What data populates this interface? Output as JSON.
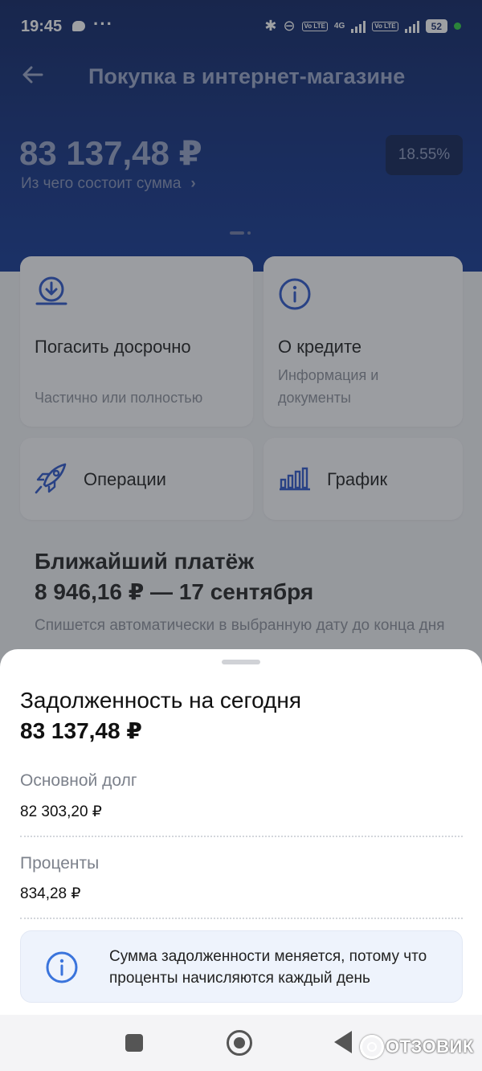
{
  "statusbar": {
    "time": "19:45",
    "dots": "···",
    "network": "4G",
    "volte1": "Vo LTE",
    "volte2": "Vo LTE",
    "battery": "52"
  },
  "header": {
    "title": "Покупка в интернет-магазине",
    "amount": "83 137,48 ₽",
    "amount_breakdown_link": "Из чего состоит сумма",
    "rate": "18.55%"
  },
  "actions": [
    {
      "title": "Погасить досрочно",
      "subtitle": "Частично или полностью",
      "icon": "download-circle-icon"
    },
    {
      "title": "О кредите",
      "subtitle": "Информация и документы",
      "icon": "info-circle-icon"
    },
    {
      "title": "Операции",
      "icon": "rocket-icon"
    },
    {
      "title": "График",
      "icon": "bar-chart-icon"
    }
  ],
  "next_payment": {
    "title": "Ближайший платёж",
    "amount_date": "8 946,16 ₽ — 17 сентября",
    "note": "Спишется автоматически в выбранную дату до конца дня"
  },
  "sheet": {
    "title": "Задолженность на сегодня",
    "total": "83 137,48 ₽",
    "rows": [
      {
        "label": "Основной долг",
        "value": "82 303,20 ₽"
      },
      {
        "label": "Проценты",
        "value": "834,28 ₽"
      }
    ],
    "info": "Сумма задолженности меняется, потому что проценты начисляются каждый день"
  },
  "watermark": "ОТЗОВИК",
  "colors": {
    "accent": "#2b54c8",
    "header_dark": "#0b2262",
    "info_bg": "#eef3fc"
  }
}
